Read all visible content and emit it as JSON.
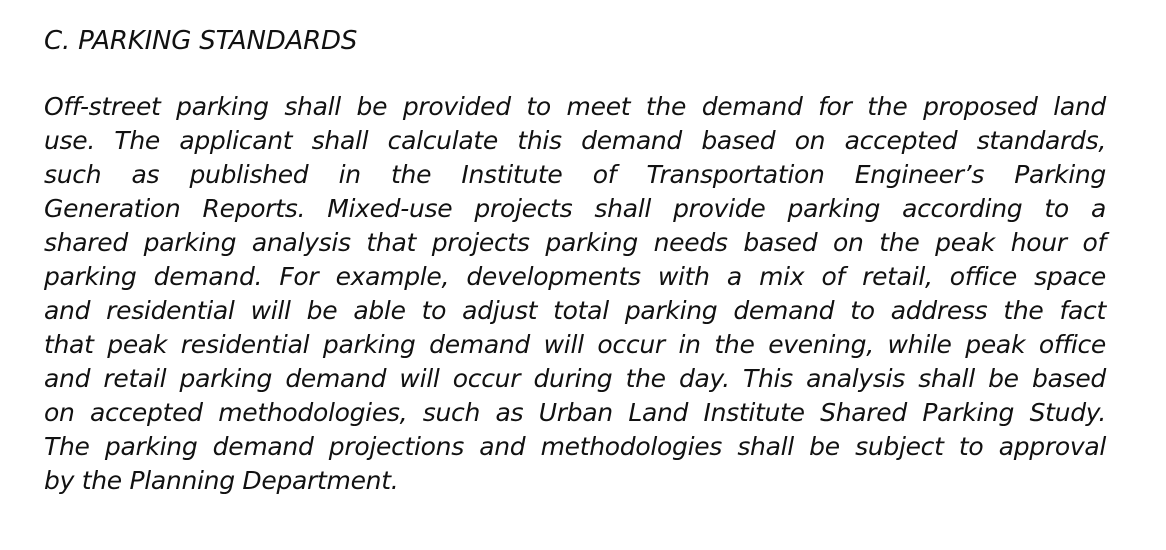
{
  "document": {
    "heading": "C. PARKING STANDARDS",
    "lines": [
      "Off-street parking shall be provided to meet the demand for the proposed land",
      "use. The applicant shall calculate this demand based on accepted standards,",
      "such as published in the Institute of Transportation Engineer’s Parking",
      "Generation Reports. Mixed-use projects shall provide parking according to a",
      "shared parking analysis that projects parking needs based on the peak hour of",
      "parking demand. For example, developments with a mix of retail, office space",
      "and residential will be able to adjust total parking demand  to address the fact",
      "that peak residential parking demand will occur in the evening, while peak office",
      "and retail parking demand will occur during the day. This analysis shall be based",
      "on accepted methodologies, such as Urban Land Institute Shared Parking Study.",
      "The parking demand projections and methodologies shall be subject to approval",
      "by the Planning Department."
    ]
  }
}
